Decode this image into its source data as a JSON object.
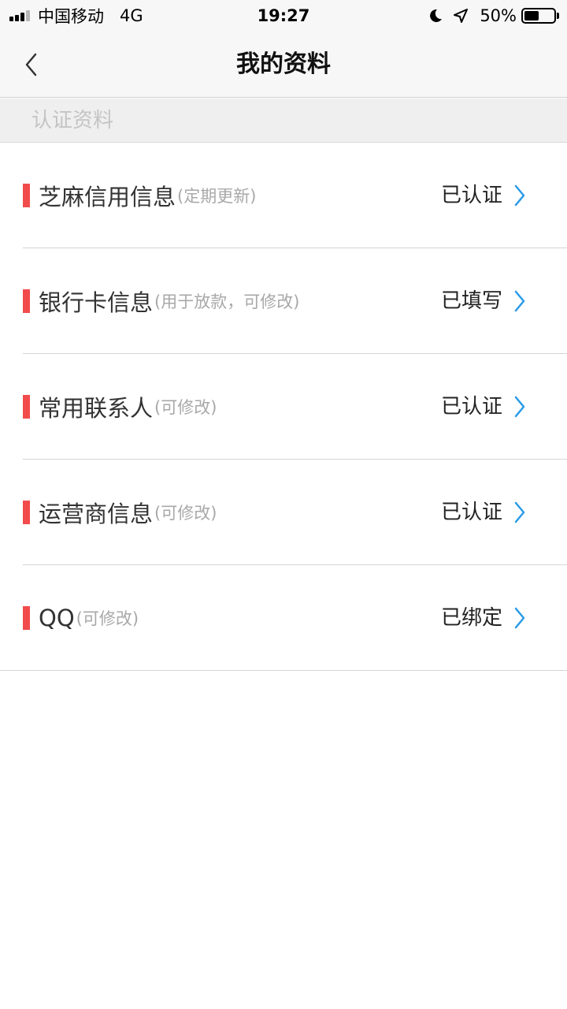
{
  "status_bar": {
    "carrier": "中国移动",
    "network": "4G",
    "time": "19:27",
    "battery_percent": "50%",
    "battery_level": 0.5
  },
  "nav": {
    "title": "我的资料",
    "back_icon": "chevron-left-icon"
  },
  "section": {
    "header": "认证资料"
  },
  "colors": {
    "accent_bar": "#f24b4b",
    "chevron": "#2b9be8"
  },
  "items": [
    {
      "title": "芝麻信用信息",
      "note": "(定期更新)",
      "status": "已认证"
    },
    {
      "title": "银行卡信息",
      "note": "(用于放款，可修改)",
      "status": "已填写"
    },
    {
      "title": "常用联系人",
      "note": "(可修改)",
      "status": "已认证"
    },
    {
      "title": "运营商信息",
      "note": "(可修改)",
      "status": "已认证"
    },
    {
      "title": "QQ",
      "note": "(可修改)",
      "status": "已绑定"
    }
  ]
}
